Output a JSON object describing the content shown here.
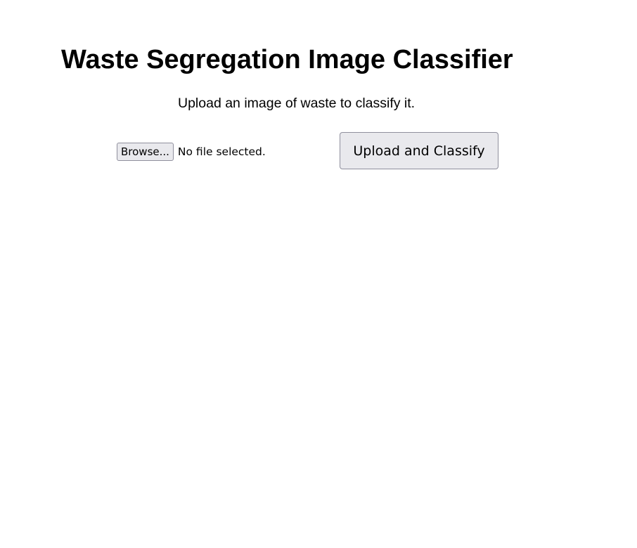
{
  "header": {
    "title": "Waste Segregation Image Classifier",
    "subtitle": "Upload an image of waste to classify it."
  },
  "upload_form": {
    "file_input": {
      "browse_label": "Browse...",
      "status_text": "No file selected."
    },
    "submit_label": "Upload and Classify"
  }
}
